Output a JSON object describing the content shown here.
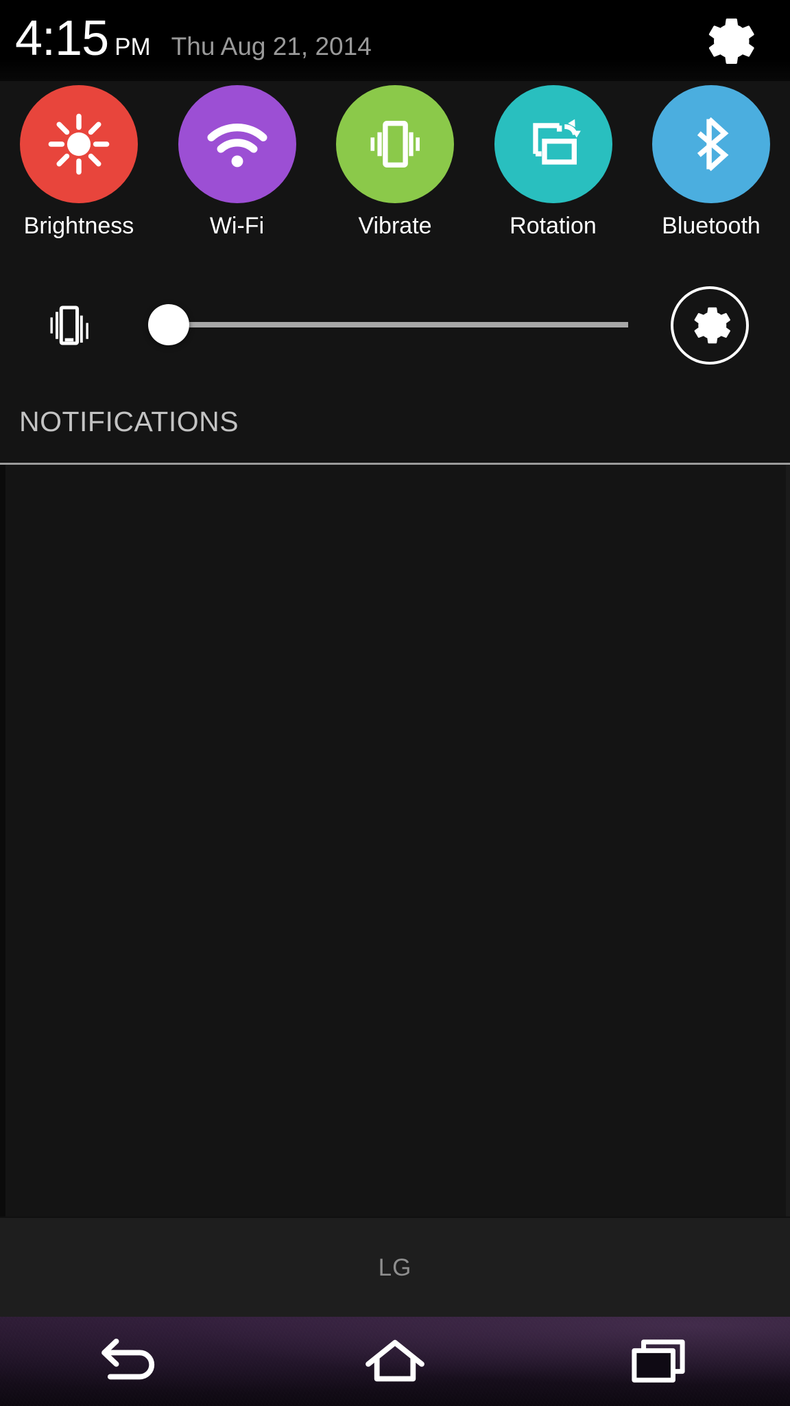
{
  "status_bar": {
    "time": "4:15",
    "ampm": "PM",
    "date": "Thu Aug 21, 2014",
    "settings_icon": "gear-icon"
  },
  "quick_toggles": {
    "items": [
      {
        "label": "Brightness",
        "icon": "brightness-sun-icon",
        "color": "#E8453C"
      },
      {
        "label": "Wi-Fi",
        "icon": "wifi-icon",
        "color": "#9C4FD4"
      },
      {
        "label": "Vibrate",
        "icon": "vibrate-phone-icon",
        "color": "#8BC94A"
      },
      {
        "label": "Rotation",
        "icon": "screen-rotation-icon",
        "color": "#29BFBF"
      },
      {
        "label": "Bluetooth",
        "icon": "bluetooth-icon",
        "color": "#4BAEDF"
      }
    ]
  },
  "slider_row": {
    "left_icon": "vibrate-phone-icon",
    "value_percent": 0,
    "track_color": "#A8A8A8",
    "thumb_color": "#FFFFFF",
    "settings_icon": "gear-icon"
  },
  "notifications": {
    "title": "NOTIFICATIONS",
    "items": [],
    "empty": true
  },
  "brand": {
    "label": "LG"
  },
  "nav_bar": {
    "buttons": [
      {
        "name": "back",
        "icon": "back-arrow-icon"
      },
      {
        "name": "home",
        "icon": "home-icon"
      },
      {
        "name": "recents",
        "icon": "recent-apps-icon"
      }
    ]
  }
}
